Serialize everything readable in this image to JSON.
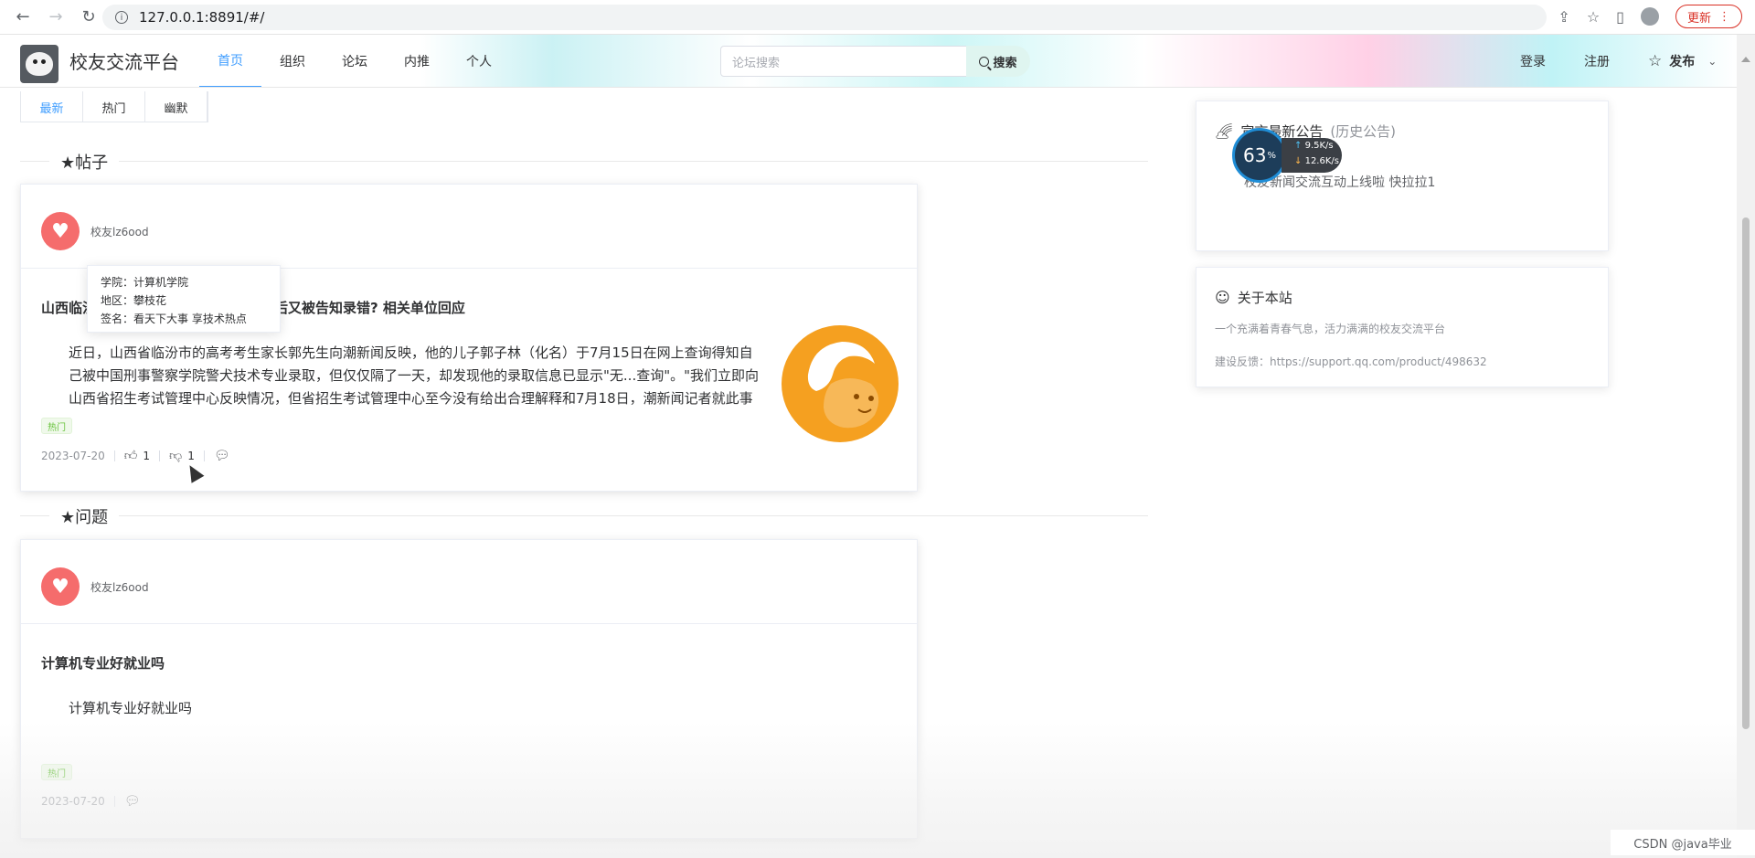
{
  "browser": {
    "url": "127.0.0.1:8891/#/",
    "update_label": "更新"
  },
  "site": {
    "title": "校友交流平台",
    "nav": [
      "首页",
      "组织",
      "论坛",
      "内推",
      "个人"
    ],
    "search_placeholder": "论坛搜索",
    "search_button": "搜索",
    "login": "登录",
    "register": "注册",
    "publish": "发布"
  },
  "sub_tabs": [
    "最新",
    "热门",
    "幽默"
  ],
  "sections": {
    "posts": "★帖子",
    "questions": "★问题"
  },
  "post_card": {
    "author": "校友lz6ood",
    "title": "山西临汾考生被中国刑事警察学院录取后又被告知录错? 相关单位回应",
    "excerpt": "近日，山西省临汾市的高考考生家长郭先生向潮新闻反映，他的儿子郭子林（化名）于7月15日在网上查询得知自己被中国刑事警察学院警犬技术专业录取，但仅仅隔了一天，却发现他的录取信息已显示\"无...查询\"。\"我们立即向山西省招生考试管理中心反映情况，但省招生考试管理中心至今没有给出合理解释和7月18日，潮新闻记者就此事致电中国刑事警察学院，工作人员表示，今年该校警犬技术专业的确在山西",
    "tag": "热门",
    "date": "2023-07-20",
    "likes": "1",
    "dislikes": "1",
    "popover": {
      "college": "学院：计算机学院",
      "region": "地区：攀枝花",
      "signature": "签名：看天下大事 享技术热点"
    }
  },
  "question_card": {
    "author": "校友lz6ood",
    "title": "计算机专业好就业吗",
    "excerpt": "计算机专业好就业吗",
    "tag": "热门",
    "date": "2023-07-20"
  },
  "notice_card": {
    "title": "宣言最新公告",
    "history": "(历史公告)",
    "content": "校友新闻交流互动上线啦 快拉拉1"
  },
  "about_card": {
    "title": "关于本站",
    "description": "一个充满着青春气息，活力满满的校友交流平台",
    "feedback": "建设反馈：https://support.qq.com/product/498632"
  },
  "speed_widget": {
    "percent": "63",
    "percent_unit": "%",
    "upload": "9.5K/s",
    "download": "12.6K/s"
  },
  "watermark": "CSDN @java毕业",
  "colors": {
    "accent": "#409eff",
    "hot_tag": "#67c23a",
    "avatar_heart": "#f56c6c",
    "illustration": "#f5a020"
  }
}
